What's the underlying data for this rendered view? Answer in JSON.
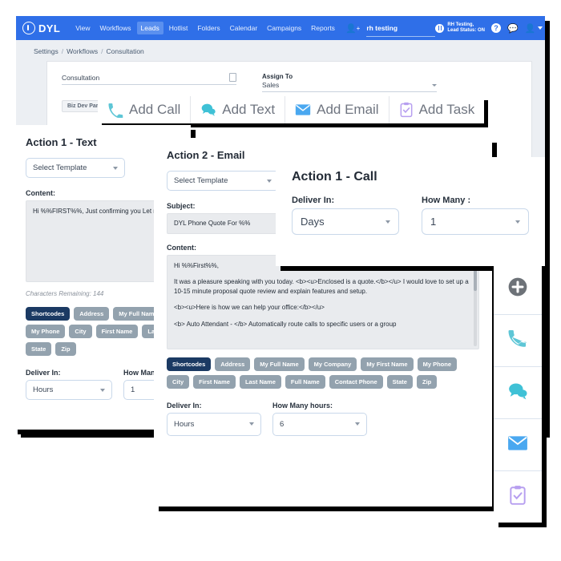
{
  "header": {
    "brand": "DYL",
    "nav_items": [
      {
        "label": "View",
        "active": false
      },
      {
        "label": "Workflows",
        "active": false
      },
      {
        "label": "Leads",
        "active": true
      },
      {
        "label": "Hotlist",
        "active": false
      },
      {
        "label": "Folders",
        "active": false
      },
      {
        "label": "Calendar",
        "active": false
      },
      {
        "label": "Campaigns",
        "active": false
      },
      {
        "label": "Reports",
        "active": false
      }
    ],
    "add_user_icon": "add-user-icon",
    "search_value": "rh testing",
    "status_line1": "RH Testing,",
    "status_line2": "Lead Status: ON",
    "pause_icon": "pause-icon",
    "help_icon": "help-icon",
    "chat_icon": "chat-icon",
    "account_icon": "account-icon",
    "nav_bg": "#2f6fe8",
    "nav_active_bg": "#5b90ef"
  },
  "breadcrumb": {
    "item1": "Settings",
    "item2": "Workflows",
    "item3": "Consultation",
    "sep": "/"
  },
  "workflow_form": {
    "name_value": "Consultation",
    "name_icon": "copy-icon",
    "assign_label": "Assign To",
    "assign_value": "Sales",
    "tag": "Biz Dev Partnership"
  },
  "add_bar": {
    "buttons": [
      {
        "label": "Add Call",
        "icon": "phone-icon",
        "color": "#5ec6d6"
      },
      {
        "label": "Add Text",
        "icon": "chat-bubble-icon",
        "color": "#3fc1d6"
      },
      {
        "label": "Add Email",
        "icon": "envelope-icon",
        "color": "#4aa8f0"
      },
      {
        "label": "Add Task",
        "icon": "clipboard-check-icon",
        "color": "#b79ff0"
      }
    ]
  },
  "action_text": {
    "title": "Action 1 - Text",
    "template_value": "Select Template",
    "content_label": "Content:",
    "content_body": "Hi %%FIRST%%, Just confirming you   Let me know if you have any questions   back! Thanks, %%AGENT_FIRST%%!",
    "chars_remaining": "Characters Remaining: 144",
    "shortcodes": [
      "Shortcodes",
      "Address",
      "My Full Name",
      "My Phone",
      "City",
      "First Name",
      "Last Name",
      "State",
      "Zip"
    ],
    "deliver_label": "Deliver In:",
    "deliver_value": "Hours",
    "howmany_label": "How Many :",
    "howmany_value": "1"
  },
  "action_email": {
    "title": "Action 2 - Email",
    "template_value": "Select Template",
    "subject_label": "Subject:",
    "subject_value": "DYL Phone Quote For %%",
    "content_label": "Content:",
    "content_p1": "Hi %%First%%,",
    "content_p2": "It was a pleasure speaking with you today. <b><u>Enclosed is a quote.</b></u> I would love to set up a 10-15 minute proposal quote review and explain features and setup.",
    "content_p3": "<b><u>Here is how we can help your office:</b></u>",
    "content_p4": "<b> Auto Attendant - </b> Automatically route calls to specific users or a group",
    "shortcodes": [
      "Shortcodes",
      "Address",
      "My Full Name",
      "My Company",
      "My First Name",
      "My Phone",
      "City",
      "First Name",
      "Last Name",
      "Full Name",
      "Contact Phone",
      "State",
      "Zip"
    ],
    "deliver_label": "Deliver In:",
    "deliver_value": "Hours",
    "howmany_label": "How Many hours:",
    "howmany_value": "6"
  },
  "action_call": {
    "title": "Action 1 - Call",
    "deliver_label": "Deliver In:",
    "deliver_value": "Days",
    "howmany_label": "How Many :",
    "howmany_value": "1"
  },
  "rail": {
    "items": [
      {
        "icon": "plus-circle-icon"
      },
      {
        "icon": "phone-icon"
      },
      {
        "icon": "chat-bubble-icon"
      },
      {
        "icon": "envelope-icon"
      },
      {
        "icon": "clipboard-check-icon"
      }
    ]
  }
}
